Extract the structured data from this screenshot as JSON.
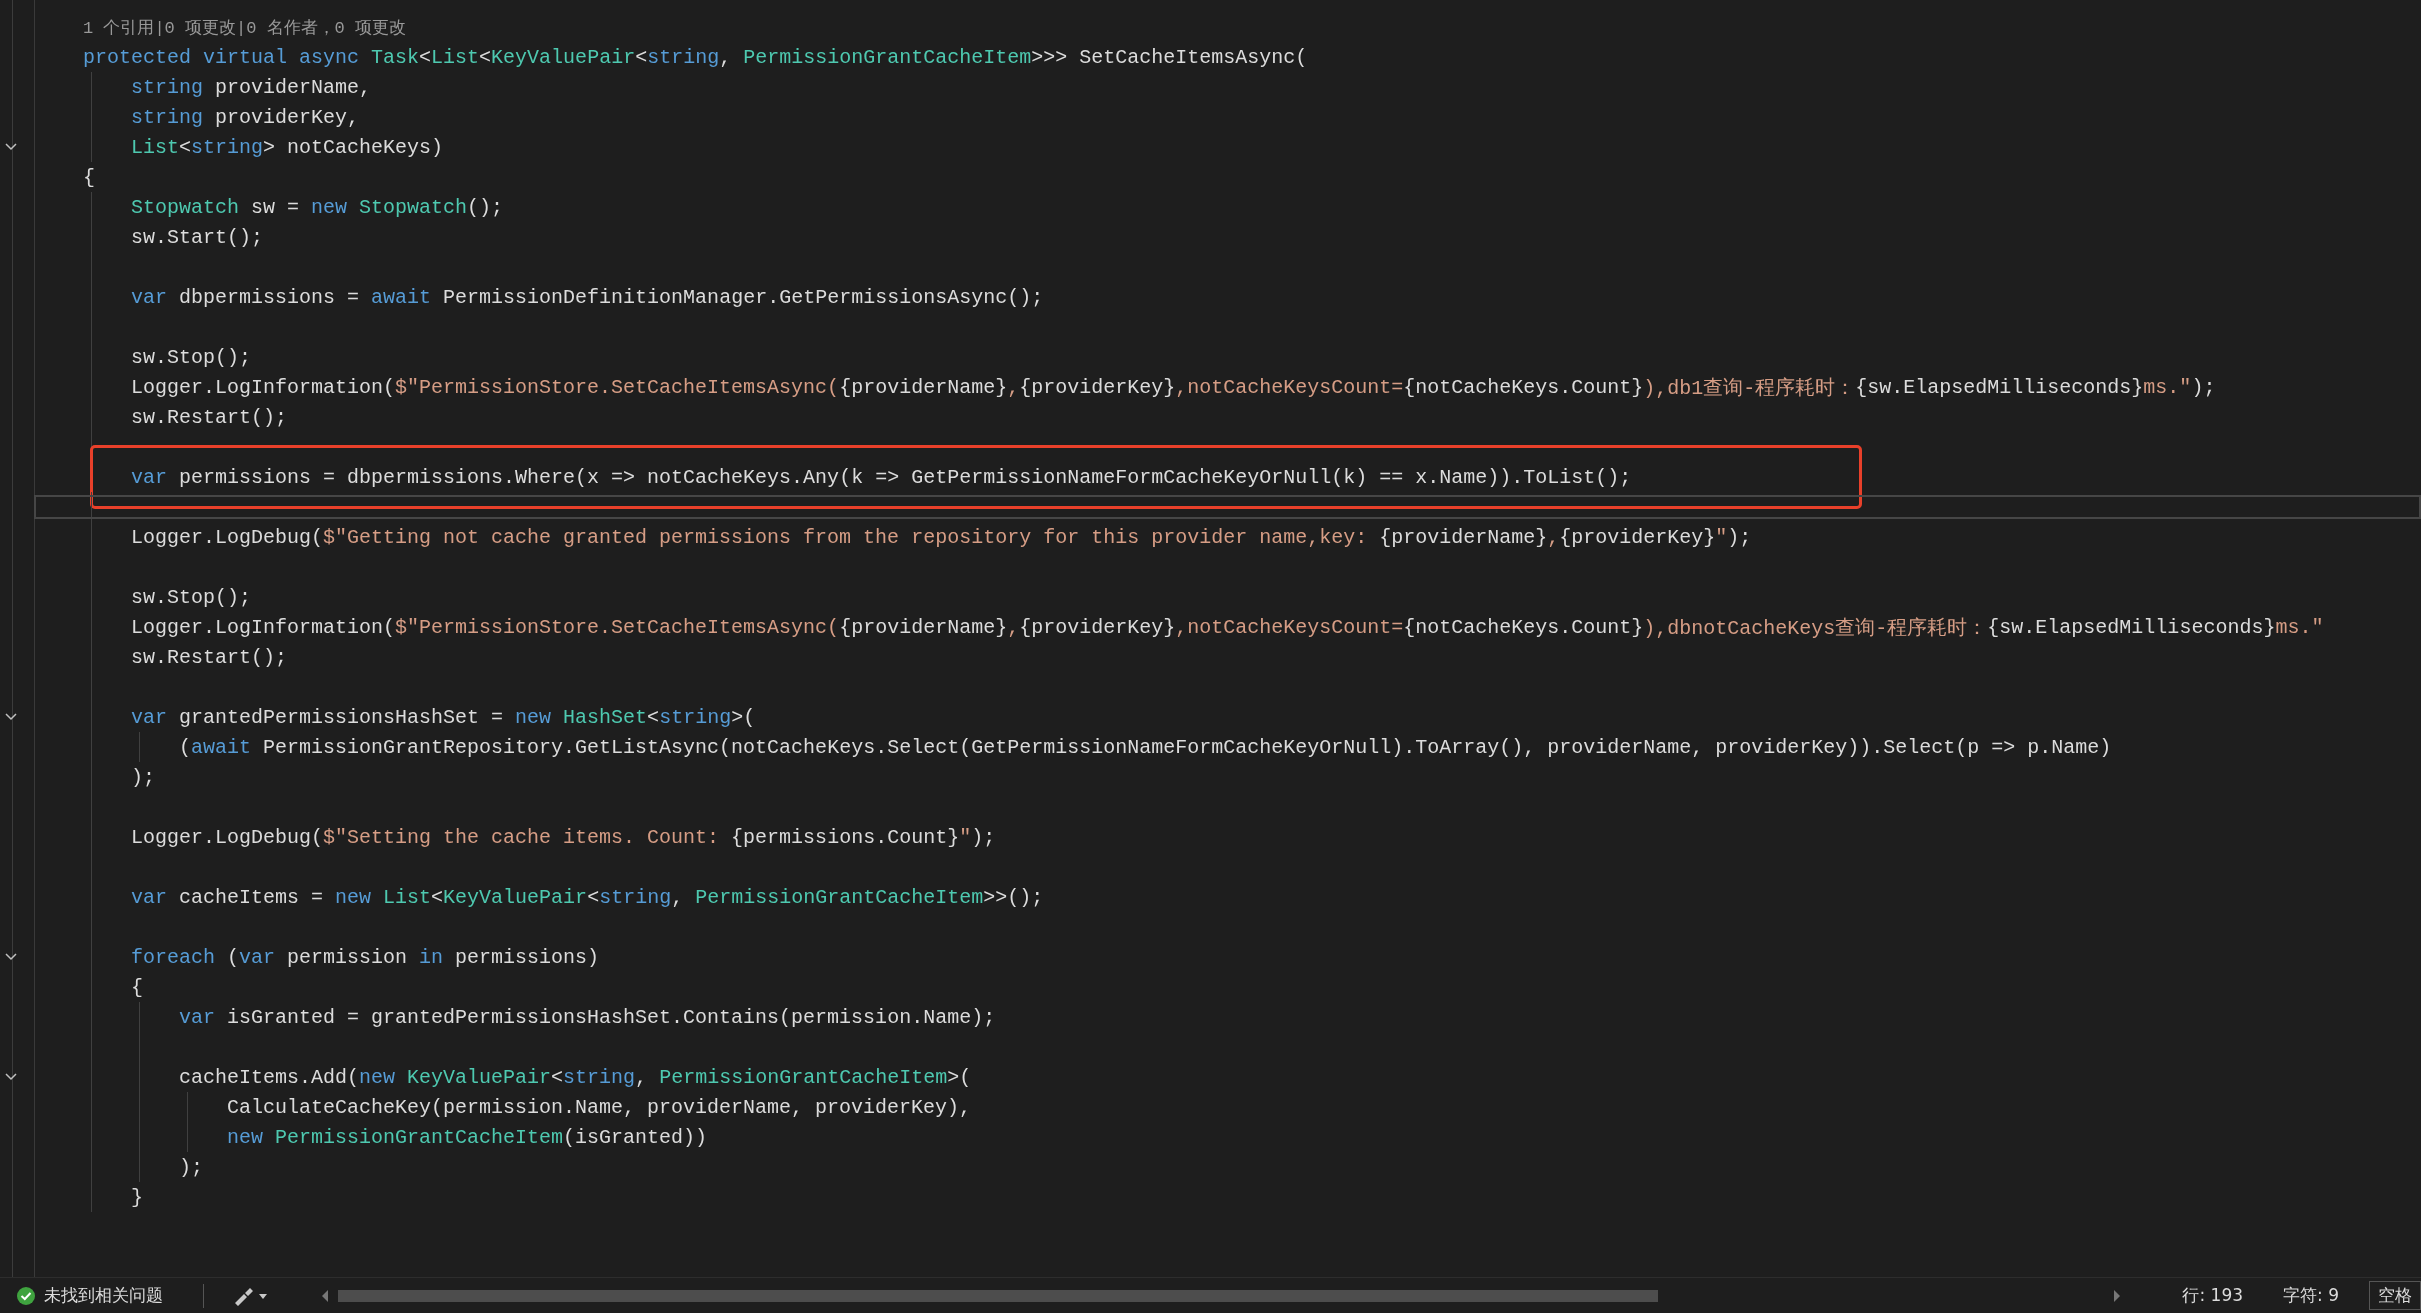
{
  "editor": {
    "lines": [
      {
        "kind": "codelens",
        "text": "1 个引用|0 项更改|0 名作者，0 项更改",
        "fold": false,
        "highlighted": false,
        "current": false
      },
      {
        "kind": "code",
        "fold": false,
        "highlighted": false,
        "current": false,
        "tokens": [
          {
            "kind": "kw",
            "text": "protected virtual async "
          },
          {
            "kind": "type",
            "text": "Task"
          },
          {
            "kind": "plain",
            "text": "<"
          },
          {
            "kind": "type",
            "text": "List"
          },
          {
            "kind": "plain",
            "text": "<"
          },
          {
            "kind": "type",
            "text": "KeyValuePair"
          },
          {
            "kind": "plain",
            "text": "<"
          },
          {
            "kind": "kw",
            "text": "string"
          },
          {
            "kind": "plain",
            "text": ", "
          },
          {
            "kind": "type",
            "text": "PermissionGrantCacheItem"
          },
          {
            "kind": "plain",
            "text": ">>> SetCacheItemsAsync("
          }
        ],
        "children": [
          {
            "kind": "code",
            "fold": false,
            "highlighted": false,
            "current": false,
            "tokens": [
              {
                "kind": "kw",
                "text": "string"
              },
              {
                "kind": "plain",
                "text": " providerName,"
              }
            ]
          },
          {
            "kind": "code",
            "fold": false,
            "highlighted": false,
            "current": false,
            "tokens": [
              {
                "kind": "kw",
                "text": "string"
              },
              {
                "kind": "plain",
                "text": " providerKey,"
              }
            ]
          },
          {
            "kind": "code",
            "fold": true,
            "highlighted": false,
            "current": false,
            "tokens": [
              {
                "kind": "type",
                "text": "List"
              },
              {
                "kind": "plain",
                "text": "<"
              },
              {
                "kind": "kw",
                "text": "string"
              },
              {
                "kind": "plain",
                "text": "> notCacheKeys)"
              }
            ]
          }
        ]
      },
      {
        "kind": "code",
        "fold": false,
        "highlighted": false,
        "current": false,
        "tokens": [
          {
            "kind": "plain",
            "text": "{"
          }
        ],
        "children": [
          {
            "kind": "code",
            "fold": false,
            "highlighted": false,
            "current": false,
            "tokens": [
              {
                "kind": "type",
                "text": "Stopwatch"
              },
              {
                "kind": "plain",
                "text": " sw = "
              },
              {
                "kind": "kw",
                "text": "new "
              },
              {
                "kind": "type",
                "text": "Stopwatch"
              },
              {
                "kind": "plain",
                "text": "();"
              }
            ]
          },
          {
            "kind": "code",
            "fold": false,
            "highlighted": false,
            "current": false,
            "tokens": [
              {
                "kind": "plain",
                "text": "sw.Start();"
              }
            ]
          },
          {
            "kind": "blank",
            "fold": false,
            "highlighted": false,
            "current": false
          },
          {
            "kind": "code",
            "fold": false,
            "highlighted": false,
            "current": false,
            "tokens": [
              {
                "kind": "kw",
                "text": "var"
              },
              {
                "kind": "plain",
                "text": " dbpermissions = "
              },
              {
                "kind": "kw",
                "text": "await"
              },
              {
                "kind": "plain",
                "text": " PermissionDefinitionManager.GetPermissionsAsync();"
              }
            ]
          },
          {
            "kind": "blank",
            "fold": false,
            "highlighted": false,
            "current": false
          },
          {
            "kind": "code",
            "fold": false,
            "highlighted": false,
            "current": false,
            "tokens": [
              {
                "kind": "plain",
                "text": "sw.Stop();"
              }
            ]
          },
          {
            "kind": "code",
            "fold": false,
            "highlighted": false,
            "current": false,
            "tokens": [
              {
                "kind": "plain",
                "text": "Logger.LogInformation("
              },
              {
                "kind": "str",
                "text": "$\"PermissionStore.SetCacheItemsAsync("
              },
              {
                "kind": "plain",
                "text": "{providerName}"
              },
              {
                "kind": "str",
                "text": ","
              },
              {
                "kind": "plain",
                "text": "{providerKey}"
              },
              {
                "kind": "str",
                "text": ",notCacheKeysCount="
              },
              {
                "kind": "plain",
                "text": "{notCacheKeys.Count}"
              },
              {
                "kind": "str",
                "text": "),db1查询-程序耗时："
              },
              {
                "kind": "plain",
                "text": "{sw.ElapsedMilliseconds}"
              },
              {
                "kind": "str",
                "text": "ms.\""
              },
              {
                "kind": "plain",
                "text": ");"
              }
            ]
          },
          {
            "kind": "code",
            "fold": false,
            "highlighted": false,
            "current": false,
            "tokens": [
              {
                "kind": "plain",
                "text": "sw.Restart();"
              }
            ]
          },
          {
            "kind": "blank",
            "fold": false,
            "highlighted": false,
            "current": false
          },
          {
            "kind": "code",
            "fold": false,
            "highlighted": true,
            "current": false,
            "tokens": [
              {
                "kind": "kw",
                "text": "var"
              },
              {
                "kind": "plain",
                "text": " permissions = dbpermissions.Where(x => notCacheKeys.Any(k => GetPermissionNameFormCacheKeyOrNull(k) == x.Name)).ToList();"
              }
            ]
          },
          {
            "kind": "blank",
            "fold": false,
            "highlighted": false,
            "current": true
          },
          {
            "kind": "code",
            "fold": false,
            "highlighted": false,
            "current": false,
            "tokens": [
              {
                "kind": "plain",
                "text": "Logger.LogDebug("
              },
              {
                "kind": "str",
                "text": "$\"Getting not cache granted permissions from the repository for this provider name,key: "
              },
              {
                "kind": "plain",
                "text": "{providerName}"
              },
              {
                "kind": "str",
                "text": ","
              },
              {
                "kind": "plain",
                "text": "{providerKey}"
              },
              {
                "kind": "str",
                "text": "\""
              },
              {
                "kind": "plain",
                "text": ");"
              }
            ]
          },
          {
            "kind": "blank",
            "fold": false,
            "highlighted": false,
            "current": false
          },
          {
            "kind": "code",
            "fold": false,
            "highlighted": false,
            "current": false,
            "tokens": [
              {
                "kind": "plain",
                "text": "sw.Stop();"
              }
            ]
          },
          {
            "kind": "code",
            "fold": false,
            "highlighted": false,
            "current": false,
            "tokens": [
              {
                "kind": "plain",
                "text": "Logger.LogInformation("
              },
              {
                "kind": "str",
                "text": "$\"PermissionStore.SetCacheItemsAsync("
              },
              {
                "kind": "plain",
                "text": "{providerName}"
              },
              {
                "kind": "str",
                "text": ","
              },
              {
                "kind": "plain",
                "text": "{providerKey}"
              },
              {
                "kind": "str",
                "text": ",notCacheKeysCount="
              },
              {
                "kind": "plain",
                "text": "{notCacheKeys.Count}"
              },
              {
                "kind": "str",
                "text": "),dbnotCacheKeys查询-程序耗时："
              },
              {
                "kind": "plain",
                "text": "{sw.ElapsedMilliseconds}"
              },
              {
                "kind": "str",
                "text": "ms.\""
              }
            ]
          },
          {
            "kind": "code",
            "fold": false,
            "highlighted": false,
            "current": false,
            "tokens": [
              {
                "kind": "plain",
                "text": "sw.Restart();"
              }
            ]
          },
          {
            "kind": "blank",
            "fold": false,
            "highlighted": false,
            "current": false
          },
          {
            "kind": "code",
            "fold": true,
            "highlighted": false,
            "current": false,
            "tokens": [
              {
                "kind": "kw",
                "text": "var"
              },
              {
                "kind": "plain",
                "text": " grantedPermissionsHashSet = "
              },
              {
                "kind": "kw",
                "text": "new "
              },
              {
                "kind": "type",
                "text": "HashSet"
              },
              {
                "kind": "plain",
                "text": "<"
              },
              {
                "kind": "kw",
                "text": "string"
              },
              {
                "kind": "plain",
                "text": ">("
              }
            ],
            "children": [
              {
                "kind": "code",
                "fold": false,
                "highlighted": false,
                "current": false,
                "tokens": [
                  {
                    "kind": "plain",
                    "text": "("
                  },
                  {
                    "kind": "kw",
                    "text": "await"
                  },
                  {
                    "kind": "plain",
                    "text": " PermissionGrantRepository.GetListAsync(notCacheKeys.Select(GetPermissionNameFormCacheKeyOrNull).ToArray(), providerName, providerKey)).Select(p => p.Name)"
                  }
                ]
              }
            ]
          },
          {
            "kind": "code",
            "fold": false,
            "highlighted": false,
            "current": false,
            "tokens": [
              {
                "kind": "plain",
                "text": ");"
              }
            ]
          },
          {
            "kind": "blank",
            "fold": false,
            "highlighted": false,
            "current": false
          },
          {
            "kind": "code",
            "fold": false,
            "highlighted": false,
            "current": false,
            "tokens": [
              {
                "kind": "plain",
                "text": "Logger.LogDebug("
              },
              {
                "kind": "str",
                "text": "$\"Setting the cache items. Count: "
              },
              {
                "kind": "plain",
                "text": "{permissions.Count}"
              },
              {
                "kind": "str",
                "text": "\""
              },
              {
                "kind": "plain",
                "text": ");"
              }
            ]
          },
          {
            "kind": "blank",
            "fold": false,
            "highlighted": false,
            "current": false
          },
          {
            "kind": "code",
            "fold": false,
            "highlighted": false,
            "current": false,
            "tokens": [
              {
                "kind": "kw",
                "text": "var"
              },
              {
                "kind": "plain",
                "text": " cacheItems = "
              },
              {
                "kind": "kw",
                "text": "new "
              },
              {
                "kind": "type",
                "text": "List"
              },
              {
                "kind": "plain",
                "text": "<"
              },
              {
                "kind": "type",
                "text": "KeyValuePair"
              },
              {
                "kind": "plain",
                "text": "<"
              },
              {
                "kind": "kw",
                "text": "string"
              },
              {
                "kind": "plain",
                "text": ", "
              },
              {
                "kind": "type",
                "text": "PermissionGrantCacheItem"
              },
              {
                "kind": "plain",
                "text": ">>();"
              }
            ]
          },
          {
            "kind": "blank",
            "fold": false,
            "highlighted": false,
            "current": false
          },
          {
            "kind": "code",
            "fold": true,
            "highlighted": false,
            "current": false,
            "tokens": [
              {
                "kind": "kw",
                "text": "foreach"
              },
              {
                "kind": "plain",
                "text": " ("
              },
              {
                "kind": "kw",
                "text": "var"
              },
              {
                "kind": "plain",
                "text": " permission "
              },
              {
                "kind": "kw",
                "text": "in"
              },
              {
                "kind": "plain",
                "text": " permissions)"
              }
            ]
          },
          {
            "kind": "code",
            "fold": false,
            "highlighted": false,
            "current": false,
            "tokens": [
              {
                "kind": "plain",
                "text": "{"
              }
            ],
            "children": [
              {
                "kind": "code",
                "fold": false,
                "highlighted": false,
                "current": false,
                "tokens": [
                  {
                    "kind": "kw",
                    "text": "var"
                  },
                  {
                    "kind": "plain",
                    "text": " isGranted = grantedPermissionsHashSet.Contains(permission.Name);"
                  }
                ]
              },
              {
                "kind": "blank",
                "fold": false,
                "highlighted": false,
                "current": false
              },
              {
                "kind": "code",
                "fold": true,
                "highlighted": false,
                "current": false,
                "tokens": [
                  {
                    "kind": "plain",
                    "text": "cacheItems.Add("
                  },
                  {
                    "kind": "kw",
                    "text": "new "
                  },
                  {
                    "kind": "type",
                    "text": "KeyValuePair"
                  },
                  {
                    "kind": "plain",
                    "text": "<"
                  },
                  {
                    "kind": "kw",
                    "text": "string"
                  },
                  {
                    "kind": "plain",
                    "text": ", "
                  },
                  {
                    "kind": "type",
                    "text": "PermissionGrantCacheItem"
                  },
                  {
                    "kind": "plain",
                    "text": ">("
                  }
                ],
                "children": [
                  {
                    "kind": "code",
                    "fold": false,
                    "highlighted": false,
                    "current": false,
                    "tokens": [
                      {
                        "kind": "plain",
                        "text": "CalculateCacheKey(permission.Name, providerName, providerKey),"
                      }
                    ]
                  },
                  {
                    "kind": "code",
                    "fold": false,
                    "highlighted": false,
                    "current": false,
                    "tokens": [
                      {
                        "kind": "kw",
                        "text": "new "
                      },
                      {
                        "kind": "type",
                        "text": "PermissionGrantCacheItem"
                      },
                      {
                        "kind": "plain",
                        "text": "(isGranted))"
                      }
                    ]
                  }
                ]
              },
              {
                "kind": "code",
                "fold": false,
                "highlighted": false,
                "current": false,
                "tokens": [
                  {
                    "kind": "plain",
                    "text": ");"
                  }
                ]
              }
            ]
          },
          {
            "kind": "code",
            "fold": false,
            "highlighted": false,
            "current": false,
            "tokens": [
              {
                "kind": "plain",
                "text": "}"
              }
            ]
          }
        ]
      },
      {
        "kind": "blank",
        "fold": false,
        "highlighted": false,
        "current": false
      }
    ]
  },
  "status_bar": {
    "problems": "未找到相关问题",
    "line": "行: 193",
    "column": "字符: 9",
    "spacing": "空格"
  }
}
